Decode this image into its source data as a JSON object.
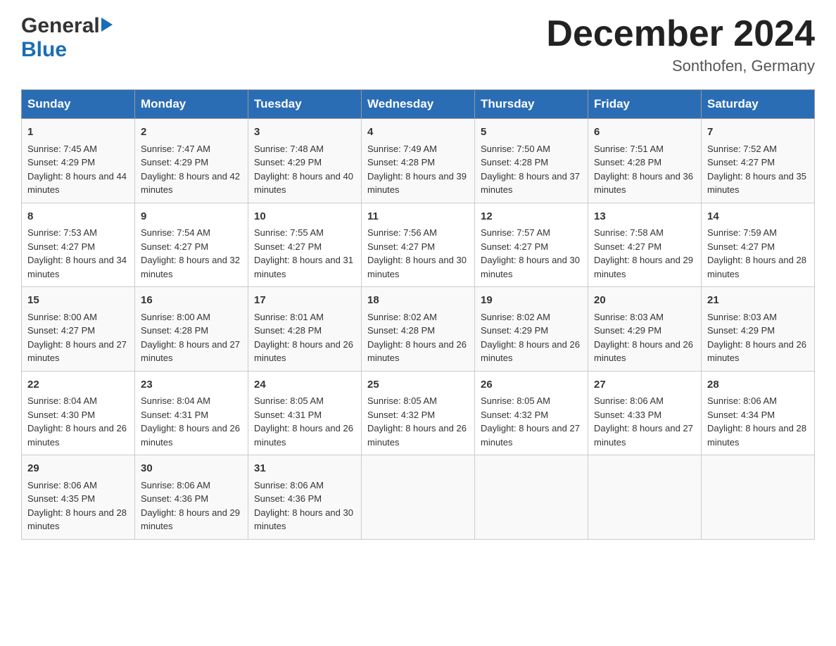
{
  "logo": {
    "general": "General",
    "blue": "Blue"
  },
  "header": {
    "month_title": "December 2024",
    "subtitle": "Sonthofen, Germany"
  },
  "days_of_week": [
    "Sunday",
    "Monday",
    "Tuesday",
    "Wednesday",
    "Thursday",
    "Friday",
    "Saturday"
  ],
  "weeks": [
    [
      {
        "day": "1",
        "sunrise": "7:45 AM",
        "sunset": "4:29 PM",
        "daylight": "8 hours and 44 minutes."
      },
      {
        "day": "2",
        "sunrise": "7:47 AM",
        "sunset": "4:29 PM",
        "daylight": "8 hours and 42 minutes."
      },
      {
        "day": "3",
        "sunrise": "7:48 AM",
        "sunset": "4:29 PM",
        "daylight": "8 hours and 40 minutes."
      },
      {
        "day": "4",
        "sunrise": "7:49 AM",
        "sunset": "4:28 PM",
        "daylight": "8 hours and 39 minutes."
      },
      {
        "day": "5",
        "sunrise": "7:50 AM",
        "sunset": "4:28 PM",
        "daylight": "8 hours and 37 minutes."
      },
      {
        "day": "6",
        "sunrise": "7:51 AM",
        "sunset": "4:28 PM",
        "daylight": "8 hours and 36 minutes."
      },
      {
        "day": "7",
        "sunrise": "7:52 AM",
        "sunset": "4:27 PM",
        "daylight": "8 hours and 35 minutes."
      }
    ],
    [
      {
        "day": "8",
        "sunrise": "7:53 AM",
        "sunset": "4:27 PM",
        "daylight": "8 hours and 34 minutes."
      },
      {
        "day": "9",
        "sunrise": "7:54 AM",
        "sunset": "4:27 PM",
        "daylight": "8 hours and 32 minutes."
      },
      {
        "day": "10",
        "sunrise": "7:55 AM",
        "sunset": "4:27 PM",
        "daylight": "8 hours and 31 minutes."
      },
      {
        "day": "11",
        "sunrise": "7:56 AM",
        "sunset": "4:27 PM",
        "daylight": "8 hours and 30 minutes."
      },
      {
        "day": "12",
        "sunrise": "7:57 AM",
        "sunset": "4:27 PM",
        "daylight": "8 hours and 30 minutes."
      },
      {
        "day": "13",
        "sunrise": "7:58 AM",
        "sunset": "4:27 PM",
        "daylight": "8 hours and 29 minutes."
      },
      {
        "day": "14",
        "sunrise": "7:59 AM",
        "sunset": "4:27 PM",
        "daylight": "8 hours and 28 minutes."
      }
    ],
    [
      {
        "day": "15",
        "sunrise": "8:00 AM",
        "sunset": "4:27 PM",
        "daylight": "8 hours and 27 minutes."
      },
      {
        "day": "16",
        "sunrise": "8:00 AM",
        "sunset": "4:28 PM",
        "daylight": "8 hours and 27 minutes."
      },
      {
        "day": "17",
        "sunrise": "8:01 AM",
        "sunset": "4:28 PM",
        "daylight": "8 hours and 26 minutes."
      },
      {
        "day": "18",
        "sunrise": "8:02 AM",
        "sunset": "4:28 PM",
        "daylight": "8 hours and 26 minutes."
      },
      {
        "day": "19",
        "sunrise": "8:02 AM",
        "sunset": "4:29 PM",
        "daylight": "8 hours and 26 minutes."
      },
      {
        "day": "20",
        "sunrise": "8:03 AM",
        "sunset": "4:29 PM",
        "daylight": "8 hours and 26 minutes."
      },
      {
        "day": "21",
        "sunrise": "8:03 AM",
        "sunset": "4:29 PM",
        "daylight": "8 hours and 26 minutes."
      }
    ],
    [
      {
        "day": "22",
        "sunrise": "8:04 AM",
        "sunset": "4:30 PM",
        "daylight": "8 hours and 26 minutes."
      },
      {
        "day": "23",
        "sunrise": "8:04 AM",
        "sunset": "4:31 PM",
        "daylight": "8 hours and 26 minutes."
      },
      {
        "day": "24",
        "sunrise": "8:05 AM",
        "sunset": "4:31 PM",
        "daylight": "8 hours and 26 minutes."
      },
      {
        "day": "25",
        "sunrise": "8:05 AM",
        "sunset": "4:32 PM",
        "daylight": "8 hours and 26 minutes."
      },
      {
        "day": "26",
        "sunrise": "8:05 AM",
        "sunset": "4:32 PM",
        "daylight": "8 hours and 27 minutes."
      },
      {
        "day": "27",
        "sunrise": "8:06 AM",
        "sunset": "4:33 PM",
        "daylight": "8 hours and 27 minutes."
      },
      {
        "day": "28",
        "sunrise": "8:06 AM",
        "sunset": "4:34 PM",
        "daylight": "8 hours and 28 minutes."
      }
    ],
    [
      {
        "day": "29",
        "sunrise": "8:06 AM",
        "sunset": "4:35 PM",
        "daylight": "8 hours and 28 minutes."
      },
      {
        "day": "30",
        "sunrise": "8:06 AM",
        "sunset": "4:36 PM",
        "daylight": "8 hours and 29 minutes."
      },
      {
        "day": "31",
        "sunrise": "8:06 AM",
        "sunset": "4:36 PM",
        "daylight": "8 hours and 30 minutes."
      },
      null,
      null,
      null,
      null
    ]
  ]
}
